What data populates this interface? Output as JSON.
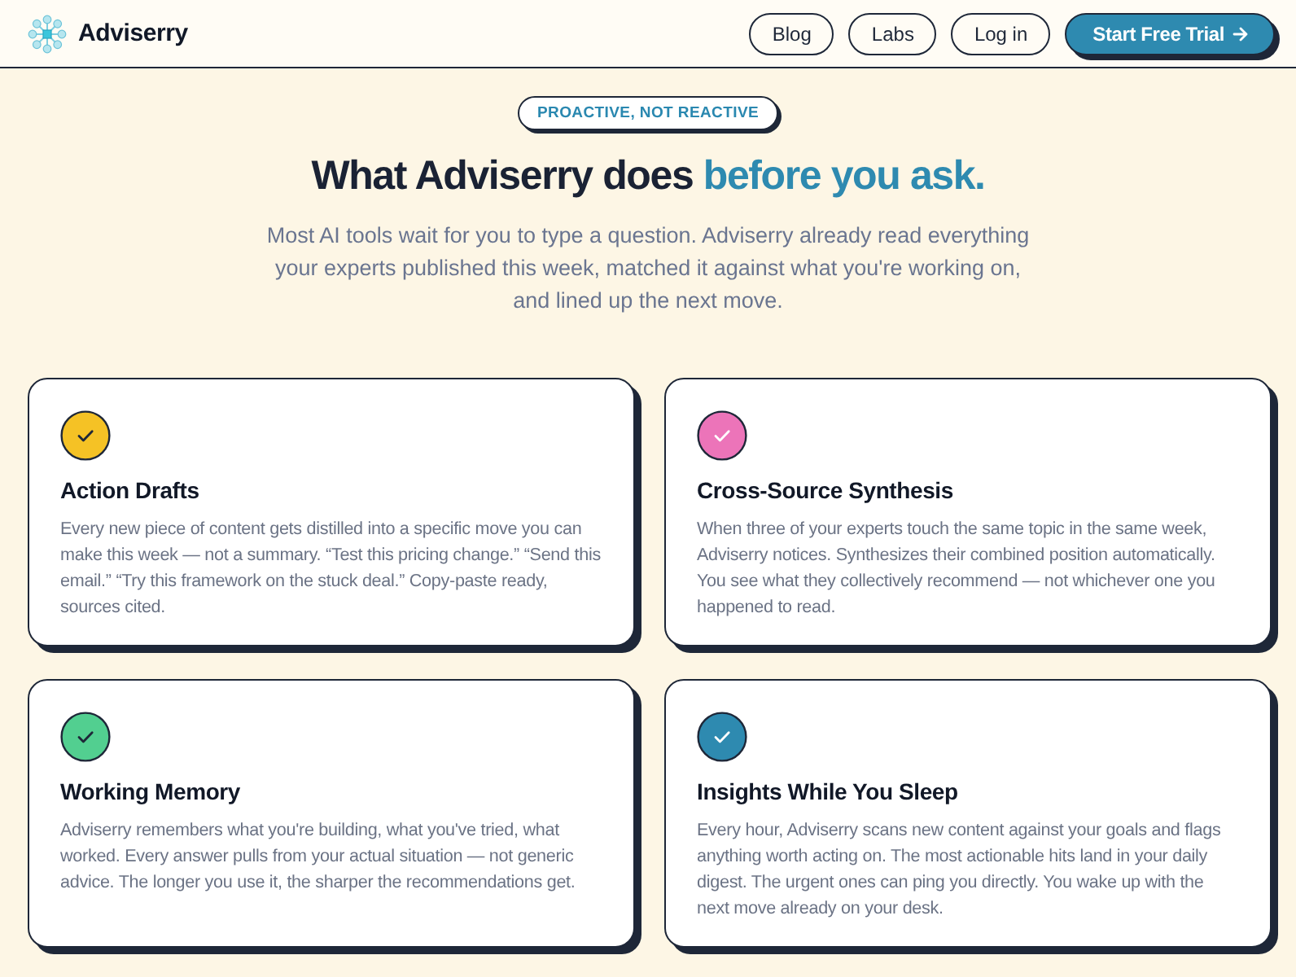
{
  "header": {
    "brand": "Adviserry",
    "nav": [
      {
        "label": "Blog",
        "kind": "outline"
      },
      {
        "label": "Labs",
        "kind": "outline"
      },
      {
        "label": "Log in",
        "kind": "outline"
      },
      {
        "label": "Start Free Trial",
        "kind": "primary"
      }
    ]
  },
  "hero": {
    "badge": "PROACTIVE, NOT REACTIVE",
    "title": "What Adviserry does",
    "title_highlight": "before you ask.",
    "subtitle": "Most AI tools wait for you to type a question. Adviserry already read everything your experts published this week, matched it against what you're working on, and lined up the next move."
  },
  "features": [
    {
      "title": "Action Drafts",
      "text": "Every new piece of content gets distilled into a specific move you can make this week — not a summary. “Test this pricing change.” “Send this email.” “Try this framework on the stuck deal.” Copy-paste ready, sources cited.",
      "color": "#f5c225"
    },
    {
      "title": "Cross-Source Synthesis",
      "text": "When three of your experts touch the same topic in the same week, Adviserry notices. Synthesizes their combined position automatically. You see what they collectively recommend — not whichever one you happened to read.",
      "color": "#ec74b9"
    },
    {
      "title": "Working Memory",
      "text": "Adviserry remembers what you're building, what you've tried, what worked. Every answer pulls from your actual situation — not generic advice. The longer you use it, the sharper the recommendations get.",
      "color": "#52cf90"
    },
    {
      "title": "Insights While You Sleep",
      "text": "Every hour, Adviserry scans new content against your goals and flags anything worth acting on. The most actionable hits land in your daily digest. The urgent ones can ping you directly. You wake up with the next move already on your desk.",
      "color": "#2e8ab0"
    }
  ]
}
